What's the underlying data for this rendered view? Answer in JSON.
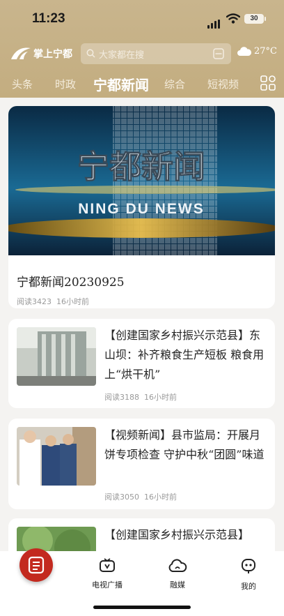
{
  "status": {
    "time": "11:23",
    "battery": "30"
  },
  "header": {
    "logo_text": "掌上宁都",
    "search_placeholder": "大家都在搜",
    "temperature": "27°C"
  },
  "tabs": [
    {
      "label": "头条"
    },
    {
      "label": "时政"
    },
    {
      "label": "宁都新闻"
    },
    {
      "label": "综合"
    },
    {
      "label": "短视频"
    }
  ],
  "feed": {
    "hero": {
      "image_caption_cn": "宁都新闻",
      "image_caption_en": "NING DU NEWS",
      "title": "宁都新闻20230925",
      "reads": "阅读3423",
      "time": "16小时前"
    },
    "items": [
      {
        "title": "【创建国家乡村振兴示范县】东山坝：补齐粮食生产短板 粮食用上“烘干机”",
        "reads": "阅读3188",
        "time": "16小时前"
      },
      {
        "title": "【视频新闻】县市监局：开展月饼专项检查 守护中秋“团圆”味道",
        "reads": "阅读3050",
        "time": "16小时前"
      },
      {
        "title": "【创建国家乡村振兴示范县】",
        "reads": "",
        "time": ""
      }
    ]
  },
  "bottom_nav": [
    {
      "label": "电视广播"
    },
    {
      "label": "融媒"
    },
    {
      "label": "我的"
    }
  ],
  "colors": {
    "header": "#c6b186",
    "accent": "#c32a1f"
  }
}
